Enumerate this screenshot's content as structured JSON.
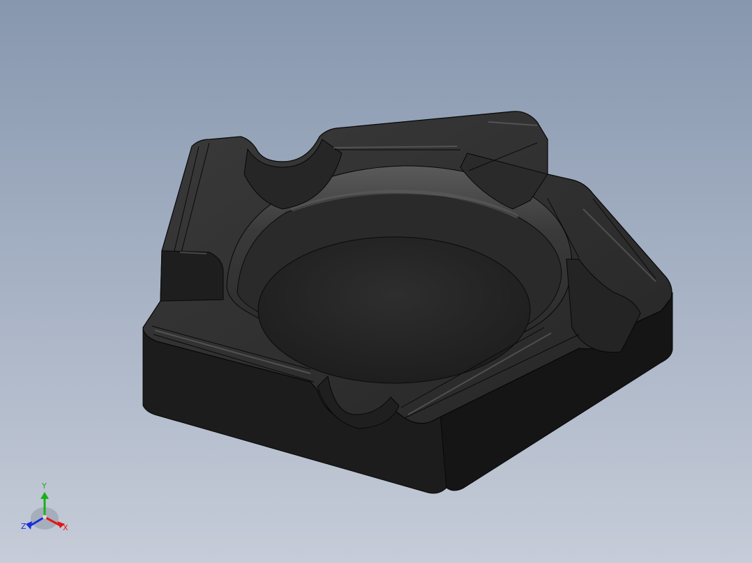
{
  "viewport": {
    "background_top": "#8797ae",
    "background_bottom": "#c6ccd8"
  },
  "model": {
    "name_icon": "pentagon-ashtray-3d-model",
    "body_color": "#232323",
    "edge_color": "#060606",
    "highlight_color": "#7a7a7a",
    "cigar_rests": 5
  },
  "triad": {
    "x_label": "X",
    "y_label": "Y",
    "z_label": "Z",
    "x_color": "#e01818",
    "y_color": "#18b018",
    "z_color": "#1830d8"
  }
}
